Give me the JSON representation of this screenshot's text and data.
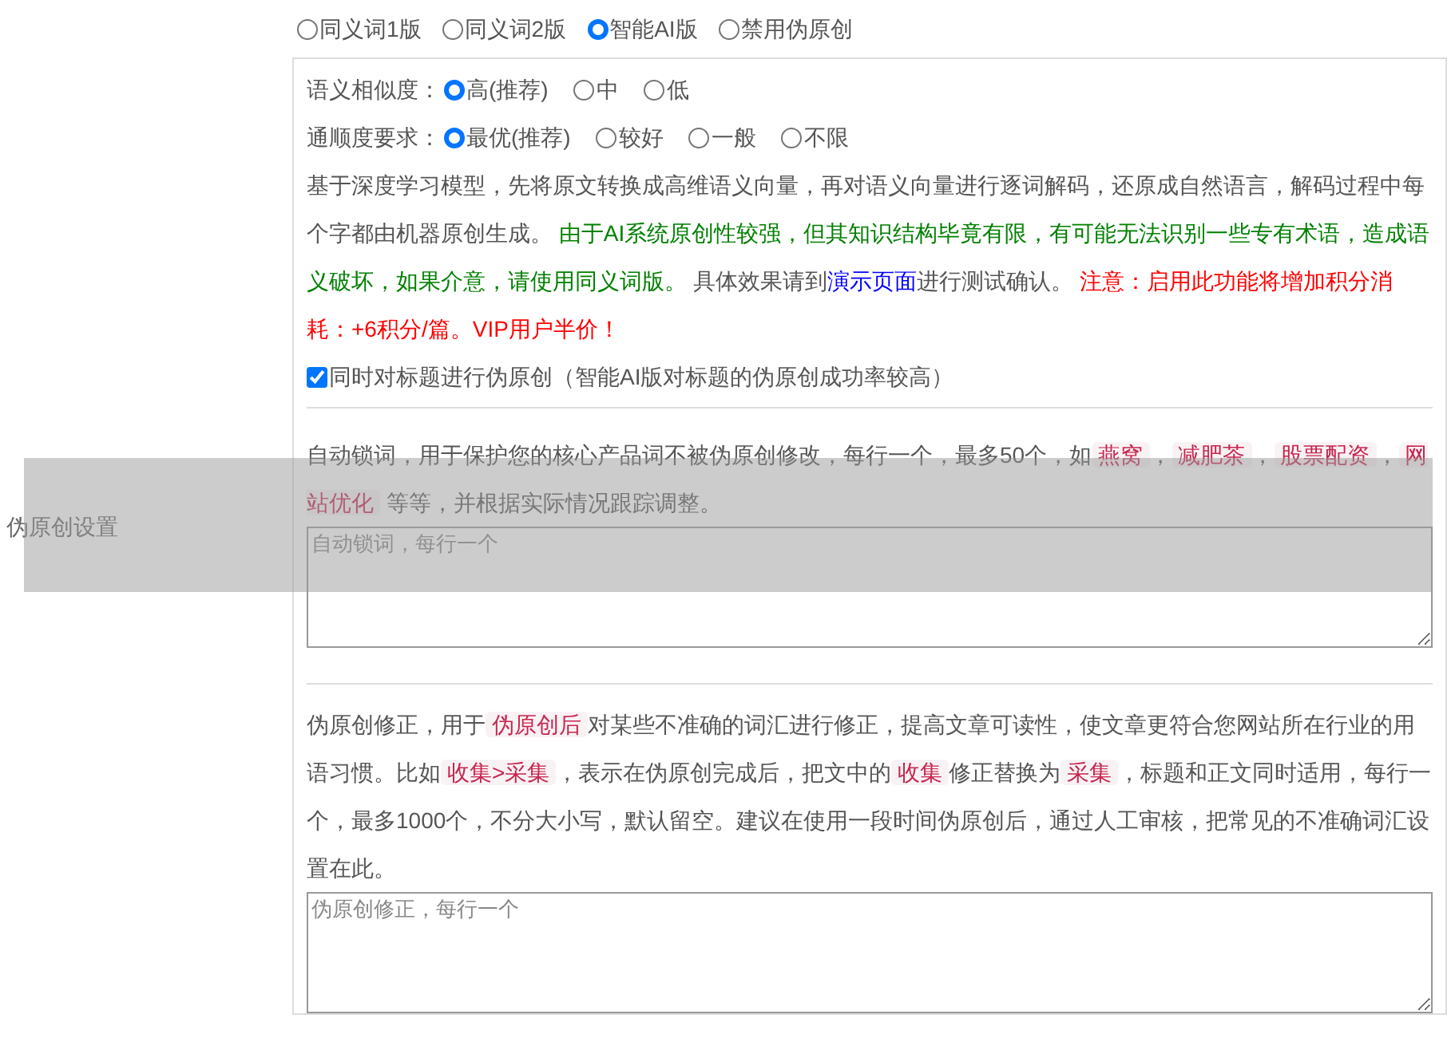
{
  "section_label": "伪原创设置",
  "versions": [
    {
      "label": "同义词1版",
      "selected": false
    },
    {
      "label": "同义词2版",
      "selected": false
    },
    {
      "label": "智能AI版",
      "selected": true
    },
    {
      "label": "禁用伪原创",
      "selected": false
    }
  ],
  "similarity": {
    "label": "语义相似度：",
    "options": [
      {
        "label": "高(推荐)",
        "selected": true
      },
      {
        "label": "中",
        "selected": false
      },
      {
        "label": "低",
        "selected": false
      }
    ]
  },
  "fluency": {
    "label": "通顺度要求：",
    "options": [
      {
        "label": "最优(推荐)",
        "selected": true
      },
      {
        "label": "较好",
        "selected": false
      },
      {
        "label": "一般",
        "selected": false
      },
      {
        "label": "不限",
        "selected": false
      }
    ]
  },
  "description": [
    {
      "kind": "text",
      "text": "基于深度学习模型，先将原文转换成高维语义向量，再对语义向量进行逐词解码，还原成自然语言，解码过程中每个字都由机器原创生成。 "
    },
    {
      "kind": "notice",
      "text": "由于AI系统原创性较强，但其知识结构毕竟有限，有可能无法识别一些专有术语，造成语义破坏，如果介意，请使用同义词版。"
    },
    {
      "kind": "text",
      "text": " 具体效果请到"
    },
    {
      "kind": "link",
      "text": "演示页面"
    },
    {
      "kind": "text",
      "text": "进行测试确认。 "
    },
    {
      "kind": "warning",
      "text": "注意：启用此功能将增加积分消耗：+6积分/篇。VIP用户半价！"
    }
  ],
  "title_option": {
    "label": "同时对标题进行伪原创（智能AI版对标题的伪原创成功率较高）",
    "checked": true
  },
  "lock_words": {
    "description": [
      {
        "kind": "text",
        "text": "自动锁词，用于保护您的核心产品词不被伪原创修改，每行一个，最多50个，如"
      },
      {
        "kind": "tag",
        "text": "燕窝"
      },
      {
        "kind": "text",
        "text": "，"
      },
      {
        "kind": "tag",
        "text": "减肥茶"
      },
      {
        "kind": "text",
        "text": "，"
      },
      {
        "kind": "tag",
        "text": "股票配资"
      },
      {
        "kind": "text",
        "text": "，"
      },
      {
        "kind": "tag",
        "text": "网站优化"
      },
      {
        "kind": "text",
        "text": " 等等，并根据实际情况跟踪调整。"
      }
    ],
    "placeholder": "自动锁词，每行一个"
  },
  "correction": {
    "description": [
      {
        "kind": "text",
        "text": "伪原创修正，用于"
      },
      {
        "kind": "tag",
        "text": "伪原创后"
      },
      {
        "kind": "text",
        "text": "对某些不准确的词汇进行修正，提高文章可读性，使文章更符合您网站所在行业的用语习惯。比如"
      },
      {
        "kind": "tag",
        "text": "收集>采集"
      },
      {
        "kind": "text",
        "text": "，表示在伪原创完成后，把文中的"
      },
      {
        "kind": "tag",
        "text": "收集"
      },
      {
        "kind": "text",
        "text": "修正替换为"
      },
      {
        "kind": "tag",
        "text": "采集"
      },
      {
        "kind": "text",
        "text": "，标题和正文同时适用，每行一个，最多1000个，不分大小写，默认留空。建议在使用一段时间伪原创后，通过人工审核，把常见的不准确词汇设置在此。"
      }
    ],
    "placeholder": "伪原创修正，每行一个"
  }
}
